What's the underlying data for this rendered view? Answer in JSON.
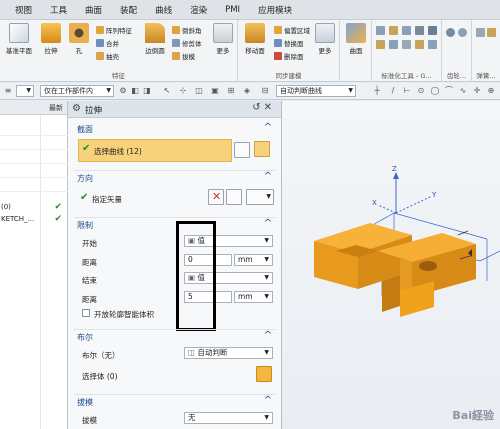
{
  "menubar": {
    "items": [
      "视图",
      "工具",
      "曲面",
      "装配",
      "曲线",
      "渲染",
      "PMI",
      "应用模块"
    ]
  },
  "ribbon": {
    "features": {
      "base_plane": "基准平面",
      "extrude": "拉伸",
      "hole": "孔",
      "pattern_feature": "阵列特征",
      "unite": "合并",
      "shell": "抽壳",
      "edge_blend": "边倒圆",
      "chamfer": "倒斜角",
      "trim_body": "修剪体",
      "draft": "拔模",
      "more": "更多",
      "group_label": "特征"
    },
    "sync": {
      "move_face": "移动面",
      "offset_region": "偏置区域",
      "replace_face": "替换面",
      "delete_face": "删除面",
      "more": "更多",
      "group_label": "同步建模"
    },
    "surface": {
      "surface": "曲面",
      "more": "更多"
    },
    "standard_tools": {
      "group_label": "标准化工具 - G..."
    },
    "gear": {
      "group_label": "齿轮..."
    },
    "spring": {
      "group_label": "弹簧..."
    }
  },
  "selection_bar": {
    "filter_value": "仅在工作部件内",
    "curve_rule": "自动判断曲线"
  },
  "navigator": {
    "header": "最新",
    "rows": [
      {
        "name": "(0)",
        "check": "✔"
      },
      {
        "name": "KETCH_...",
        "check": "✔"
      }
    ]
  },
  "dialog": {
    "title": "拉伸",
    "section": {
      "header": "截面",
      "select_curve": "选择曲线 (12)"
    },
    "direction": {
      "header": "方向",
      "specify_vector": "指定矢量"
    },
    "limits": {
      "header": "限制",
      "start_label": "开始",
      "start_value": "值",
      "start_distance_label": "距离",
      "start_distance": "0",
      "start_unit": "mm",
      "end_label": "结束",
      "end_value": "值",
      "end_distance_label": "距离",
      "end_distance": "5",
      "end_unit": "mm",
      "open_profile": "开放轮廓智能体积"
    },
    "boolean": {
      "header": "布尔",
      "boolean_label": "布尔（无）",
      "boolean_value": "自动判断",
      "select_body": "选择体 (0)"
    },
    "draft": {
      "header": "拔模",
      "draft_label": "拔模",
      "draft_value": "无"
    }
  },
  "viewport": {
    "axis_z": "Z",
    "axis_x": "X",
    "axis_y": "Y",
    "watermark": "Bai経验"
  },
  "colors": {
    "accent_part": "#f0a21c",
    "highlight": "#f8d27a",
    "ok": "#2a8a2a",
    "annotation_box": "#000000"
  }
}
